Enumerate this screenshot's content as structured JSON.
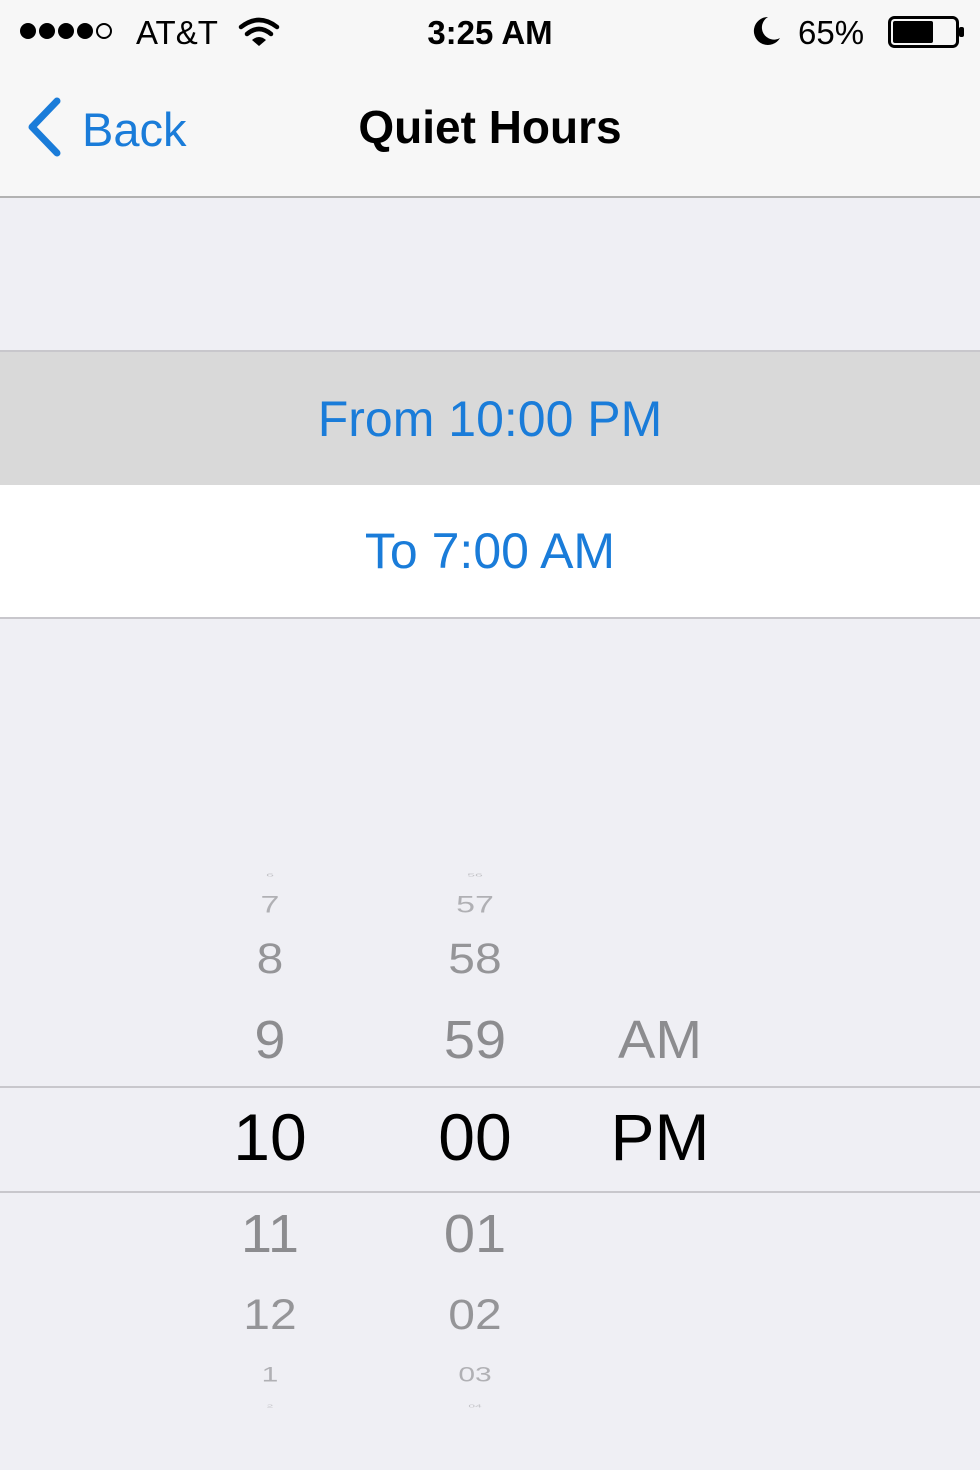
{
  "status_bar": {
    "carrier": "AT&T",
    "time": "3:25 AM",
    "battery_percent": "65%",
    "battery_level": 0.65,
    "signal_bars_filled": 4,
    "signal_bars_total": 5
  },
  "nav": {
    "back_label": "Back",
    "title": "Quiet Hours"
  },
  "schedule": {
    "from": "From 10:00 PM",
    "to": "To 7:00 AM"
  },
  "picker": {
    "hours": [
      "6",
      "7",
      "8",
      "9",
      "10",
      "11",
      "12",
      "1",
      "2"
    ],
    "minutes": [
      "56",
      "57",
      "58",
      "59",
      "00",
      "01",
      "02",
      "03",
      "04"
    ],
    "periods": [
      "AM",
      "PM"
    ],
    "selected_hour": "10",
    "selected_minute": "00",
    "selected_period": "PM"
  },
  "colors": {
    "accent": "#1a7cd9",
    "background": "#efeff4",
    "selected_row": "#d9d9d9"
  },
  "icons": {
    "back": "chevron-left-icon",
    "wifi": "wifi-icon",
    "do_not_disturb": "moon-icon",
    "battery": "battery-icon"
  }
}
